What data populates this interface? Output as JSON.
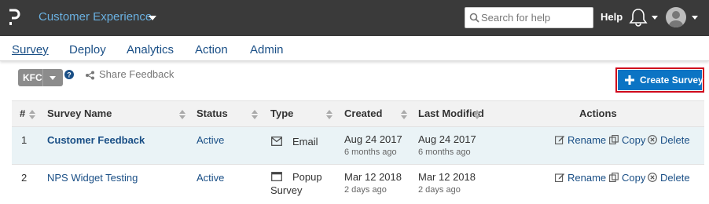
{
  "header": {
    "app_title": "Customer Experience",
    "search_placeholder": "Search for help",
    "help_label": "Help",
    "accent_color": "#6ab0e0",
    "bar_color": "#3a3a3a"
  },
  "nav": {
    "tabs": [
      {
        "label": "Survey",
        "active": true
      },
      {
        "label": "Deploy",
        "active": false
      },
      {
        "label": "Analytics",
        "active": false
      },
      {
        "label": "Action",
        "active": false
      },
      {
        "label": "Admin",
        "active": false
      }
    ]
  },
  "toolbar": {
    "brand_label": "KFC",
    "share_label": "Share Feedback",
    "create_label": "Create Survey",
    "create_color": "#0b74c4",
    "highlight_color": "#d0021b"
  },
  "table": {
    "headers": {
      "num": "#",
      "name": "Survey Name",
      "status": "Status",
      "type": "Type",
      "created": "Created",
      "modified": "Last Modified",
      "actions": "Actions"
    },
    "rows": [
      {
        "num": "1",
        "name": "Customer Feedback",
        "status": "Active",
        "type_icon": "email-icon",
        "type_line1": "Email",
        "type_line2": "",
        "created": "Aug 24 2017",
        "created_ago": "6 months ago",
        "modified": "Aug 24 2017",
        "modified_ago": "6 months ago"
      },
      {
        "num": "2",
        "name": "NPS Widget Testing",
        "status": "Active",
        "type_icon": "popup-window-icon",
        "type_line1": "Popup",
        "type_line2": "Survey",
        "created": "Mar 12 2018",
        "created_ago": "2 days ago",
        "modified": "Mar 12 2018",
        "modified_ago": "2 days ago"
      }
    ],
    "actions": {
      "rename": "Rename",
      "copy": "Copy",
      "delete": "Delete"
    }
  }
}
